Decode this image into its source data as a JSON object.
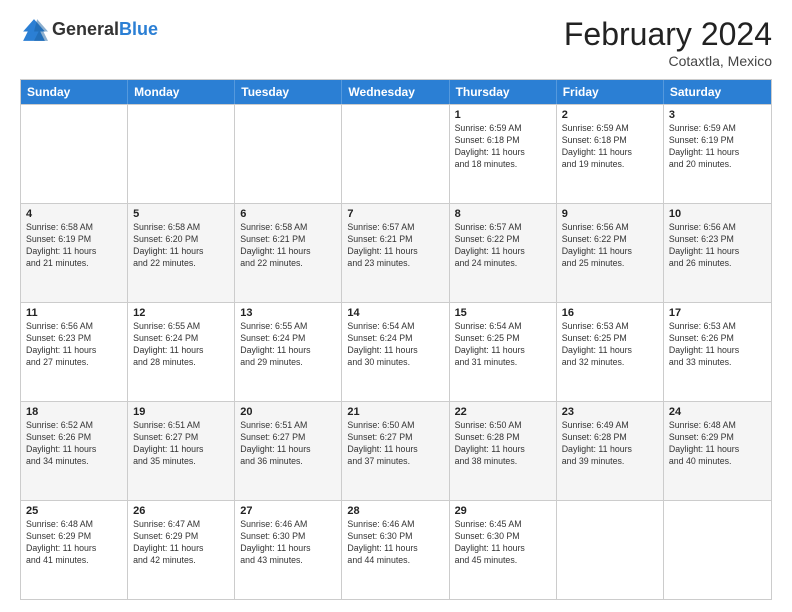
{
  "header": {
    "logo": {
      "general": "General",
      "blue": "Blue"
    },
    "title": "February 2024",
    "location": "Cotaxtla, Mexico"
  },
  "weekdays": [
    "Sunday",
    "Monday",
    "Tuesday",
    "Wednesday",
    "Thursday",
    "Friday",
    "Saturday"
  ],
  "rows": [
    [
      {
        "day": "",
        "info": ""
      },
      {
        "day": "",
        "info": ""
      },
      {
        "day": "",
        "info": ""
      },
      {
        "day": "",
        "info": ""
      },
      {
        "day": "1",
        "info": "Sunrise: 6:59 AM\nSunset: 6:18 PM\nDaylight: 11 hours\nand 18 minutes."
      },
      {
        "day": "2",
        "info": "Sunrise: 6:59 AM\nSunset: 6:18 PM\nDaylight: 11 hours\nand 19 minutes."
      },
      {
        "day": "3",
        "info": "Sunrise: 6:59 AM\nSunset: 6:19 PM\nDaylight: 11 hours\nand 20 minutes."
      }
    ],
    [
      {
        "day": "4",
        "info": "Sunrise: 6:58 AM\nSunset: 6:19 PM\nDaylight: 11 hours\nand 21 minutes."
      },
      {
        "day": "5",
        "info": "Sunrise: 6:58 AM\nSunset: 6:20 PM\nDaylight: 11 hours\nand 22 minutes."
      },
      {
        "day": "6",
        "info": "Sunrise: 6:58 AM\nSunset: 6:21 PM\nDaylight: 11 hours\nand 22 minutes."
      },
      {
        "day": "7",
        "info": "Sunrise: 6:57 AM\nSunset: 6:21 PM\nDaylight: 11 hours\nand 23 minutes."
      },
      {
        "day": "8",
        "info": "Sunrise: 6:57 AM\nSunset: 6:22 PM\nDaylight: 11 hours\nand 24 minutes."
      },
      {
        "day": "9",
        "info": "Sunrise: 6:56 AM\nSunset: 6:22 PM\nDaylight: 11 hours\nand 25 minutes."
      },
      {
        "day": "10",
        "info": "Sunrise: 6:56 AM\nSunset: 6:23 PM\nDaylight: 11 hours\nand 26 minutes."
      }
    ],
    [
      {
        "day": "11",
        "info": "Sunrise: 6:56 AM\nSunset: 6:23 PM\nDaylight: 11 hours\nand 27 minutes."
      },
      {
        "day": "12",
        "info": "Sunrise: 6:55 AM\nSunset: 6:24 PM\nDaylight: 11 hours\nand 28 minutes."
      },
      {
        "day": "13",
        "info": "Sunrise: 6:55 AM\nSunset: 6:24 PM\nDaylight: 11 hours\nand 29 minutes."
      },
      {
        "day": "14",
        "info": "Sunrise: 6:54 AM\nSunset: 6:24 PM\nDaylight: 11 hours\nand 30 minutes."
      },
      {
        "day": "15",
        "info": "Sunrise: 6:54 AM\nSunset: 6:25 PM\nDaylight: 11 hours\nand 31 minutes."
      },
      {
        "day": "16",
        "info": "Sunrise: 6:53 AM\nSunset: 6:25 PM\nDaylight: 11 hours\nand 32 minutes."
      },
      {
        "day": "17",
        "info": "Sunrise: 6:53 AM\nSunset: 6:26 PM\nDaylight: 11 hours\nand 33 minutes."
      }
    ],
    [
      {
        "day": "18",
        "info": "Sunrise: 6:52 AM\nSunset: 6:26 PM\nDaylight: 11 hours\nand 34 minutes."
      },
      {
        "day": "19",
        "info": "Sunrise: 6:51 AM\nSunset: 6:27 PM\nDaylight: 11 hours\nand 35 minutes."
      },
      {
        "day": "20",
        "info": "Sunrise: 6:51 AM\nSunset: 6:27 PM\nDaylight: 11 hours\nand 36 minutes."
      },
      {
        "day": "21",
        "info": "Sunrise: 6:50 AM\nSunset: 6:27 PM\nDaylight: 11 hours\nand 37 minutes."
      },
      {
        "day": "22",
        "info": "Sunrise: 6:50 AM\nSunset: 6:28 PM\nDaylight: 11 hours\nand 38 minutes."
      },
      {
        "day": "23",
        "info": "Sunrise: 6:49 AM\nSunset: 6:28 PM\nDaylight: 11 hours\nand 39 minutes."
      },
      {
        "day": "24",
        "info": "Sunrise: 6:48 AM\nSunset: 6:29 PM\nDaylight: 11 hours\nand 40 minutes."
      }
    ],
    [
      {
        "day": "25",
        "info": "Sunrise: 6:48 AM\nSunset: 6:29 PM\nDaylight: 11 hours\nand 41 minutes."
      },
      {
        "day": "26",
        "info": "Sunrise: 6:47 AM\nSunset: 6:29 PM\nDaylight: 11 hours\nand 42 minutes."
      },
      {
        "day": "27",
        "info": "Sunrise: 6:46 AM\nSunset: 6:30 PM\nDaylight: 11 hours\nand 43 minutes."
      },
      {
        "day": "28",
        "info": "Sunrise: 6:46 AM\nSunset: 6:30 PM\nDaylight: 11 hours\nand 44 minutes."
      },
      {
        "day": "29",
        "info": "Sunrise: 6:45 AM\nSunset: 6:30 PM\nDaylight: 11 hours\nand 45 minutes."
      },
      {
        "day": "",
        "info": ""
      },
      {
        "day": "",
        "info": ""
      }
    ]
  ]
}
